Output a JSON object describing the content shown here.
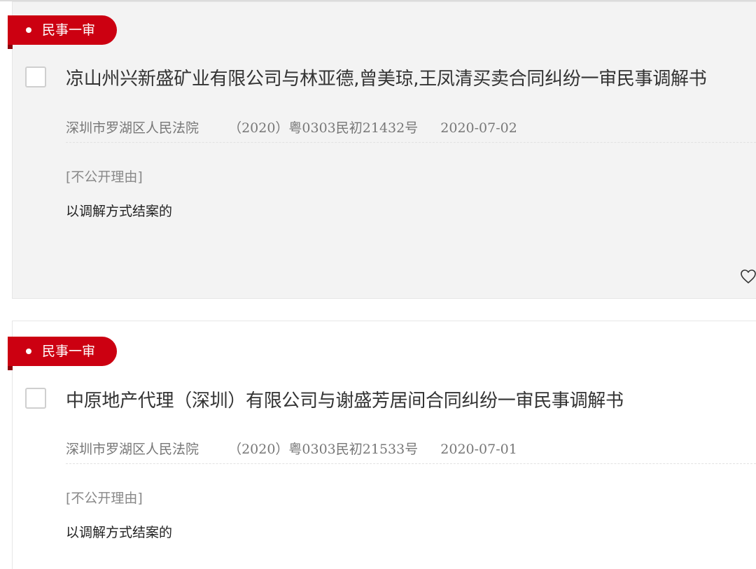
{
  "results": [
    {
      "badge": "民事一审",
      "title": "凉山州兴新盛矿业有限公司与林亚德,曾美琼,王凤清买卖合同纠纷一审民事调解书",
      "court": "深圳市罗湖区人民法院",
      "case_number": "（2020）粤0303民初21432号",
      "date": "2020-07-02",
      "reason_label": "[不公开理由]",
      "reason_text": "以调解方式结案的"
    },
    {
      "badge": "民事一审",
      "title": "中原地产代理（深圳）有限公司与谢盛芳居间合同纠纷一审民事调解书",
      "court": "深圳市罗湖区人民法院",
      "case_number": "（2020）粤0303民初21533号",
      "date": "2020-07-01",
      "reason_label": "[不公开理由]",
      "reason_text": "以调解方式结案的"
    }
  ],
  "icons": {
    "favorite": "heart-outline-icon",
    "bullet": "dot-icon"
  },
  "colors": {
    "badge_red": "#cc0011",
    "card_hover_bg": "#f3f3f3"
  }
}
